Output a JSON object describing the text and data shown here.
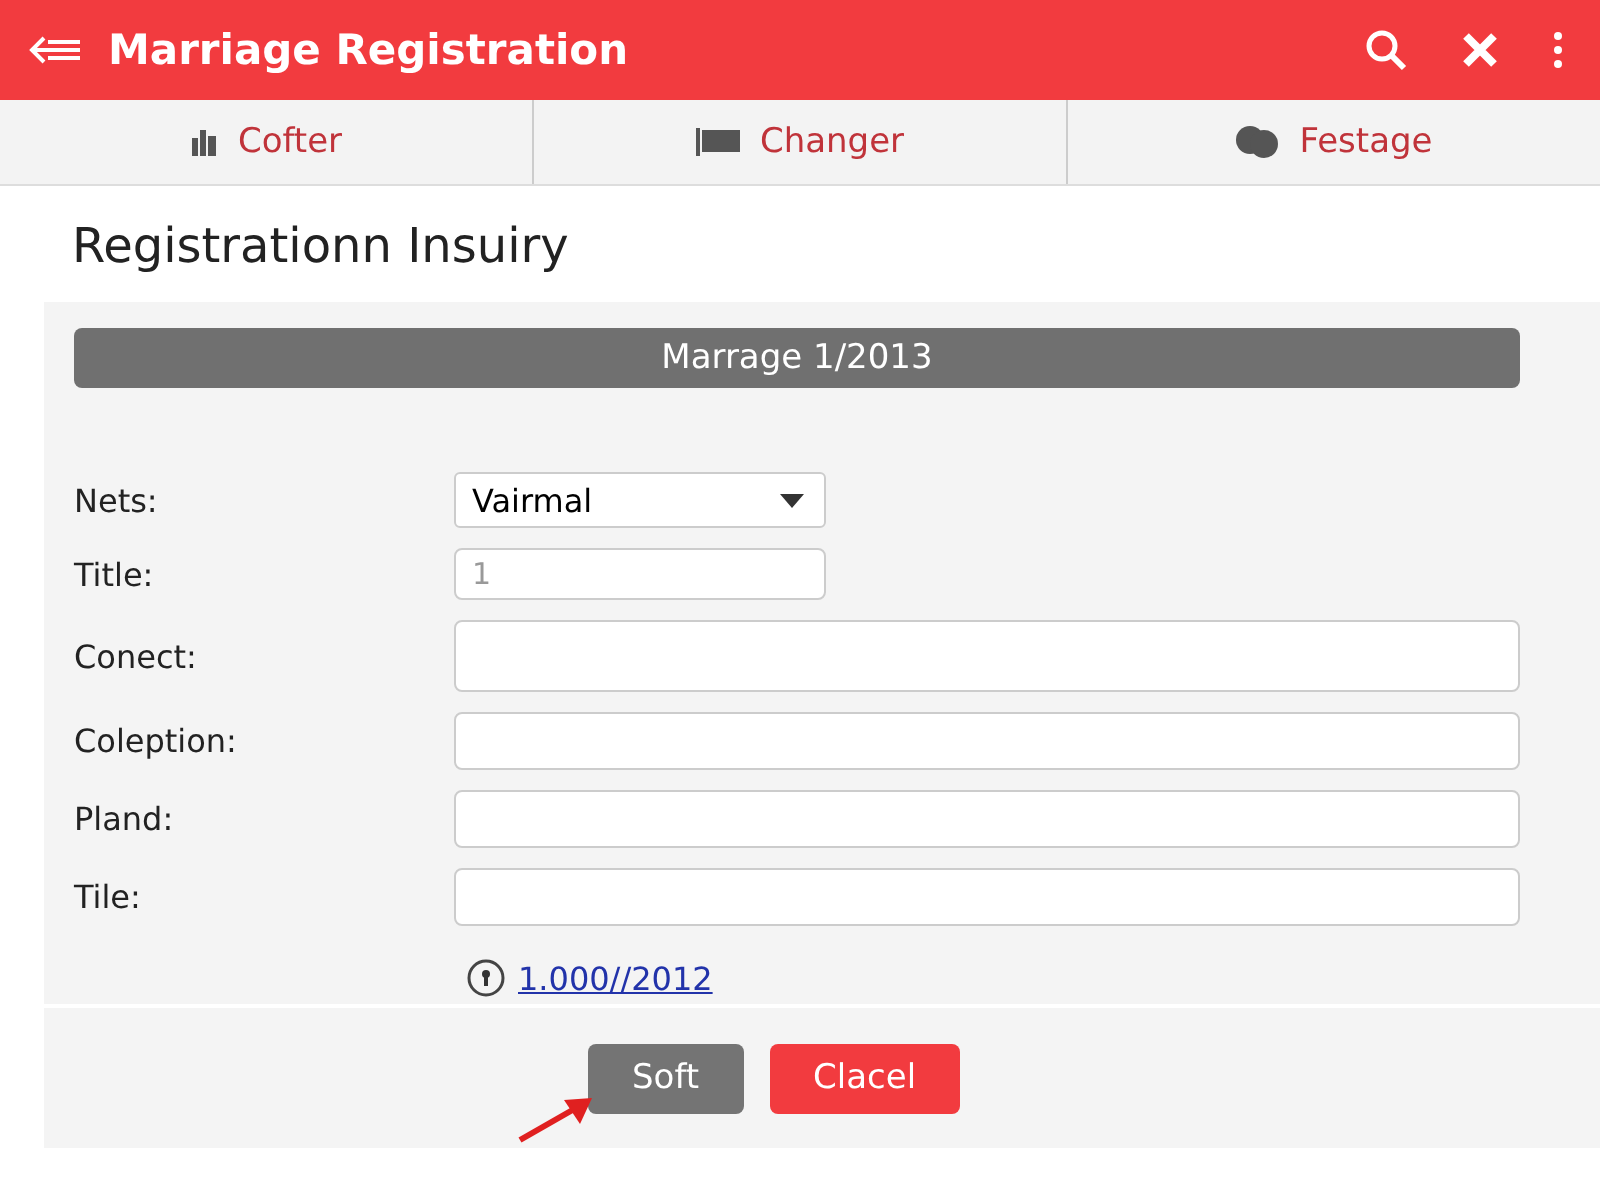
{
  "app_bar": {
    "title": "Marriage Registration"
  },
  "tabs": [
    {
      "label": "Cofter",
      "selected": false
    },
    {
      "label": "Changer",
      "selected": false
    },
    {
      "label": "Festage",
      "selected": false
    }
  ],
  "heading": "Registrationn Insuiry",
  "section_bar": "Marrage 1/2013",
  "fields": [
    {
      "kind": "select",
      "label": "Nets:",
      "value": "Vairmal"
    },
    {
      "kind": "short",
      "label": "Title:",
      "value": "1"
    },
    {
      "kind": "tall",
      "label": "Conect:"
    },
    {
      "kind": "text",
      "label": "Coleption:"
    },
    {
      "kind": "text",
      "label": "Pland:"
    },
    {
      "kind": "text",
      "label": "Tile:"
    }
  ],
  "link": "1.000//2012",
  "buttons": [
    {
      "kind": "primary",
      "label": "Soft"
    },
    {
      "kind": "danger",
      "label": "Clacel"
    }
  ]
}
